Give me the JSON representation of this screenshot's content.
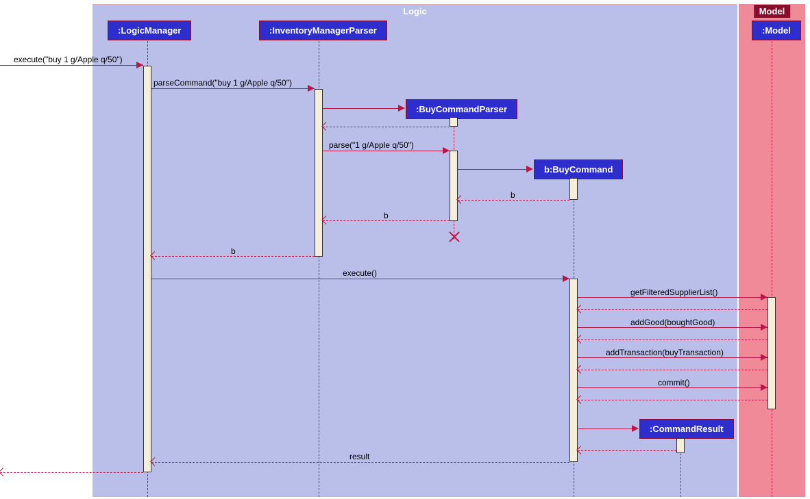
{
  "frames": {
    "logic": {
      "label": "Logic"
    },
    "model": {
      "label": "Model"
    }
  },
  "participants": {
    "logicManager": ":LogicManager",
    "invParser": ":InventoryManagerParser",
    "buyCmdParser": ":BuyCommandParser",
    "buyCmd": "b:BuyCommand",
    "model": ":Model",
    "cmdResult": ":CommandResult"
  },
  "messages": {
    "execEntry": "execute(\"buy 1 g/Apple q/50\")",
    "parseCmd": "parseCommand(\"buy 1 g/Apple q/50\")",
    "parse": "parse(\"1 g/Apple q/50\")",
    "retB1": "b",
    "retB2": "b",
    "retB3": "b",
    "execute": "execute()",
    "getList": "getFilteredSupplierList()",
    "addGood": "addGood(boughtGood)",
    "addTxn": "addTransaction(buyTransaction)",
    "commit": "commit()",
    "result": "result"
  }
}
